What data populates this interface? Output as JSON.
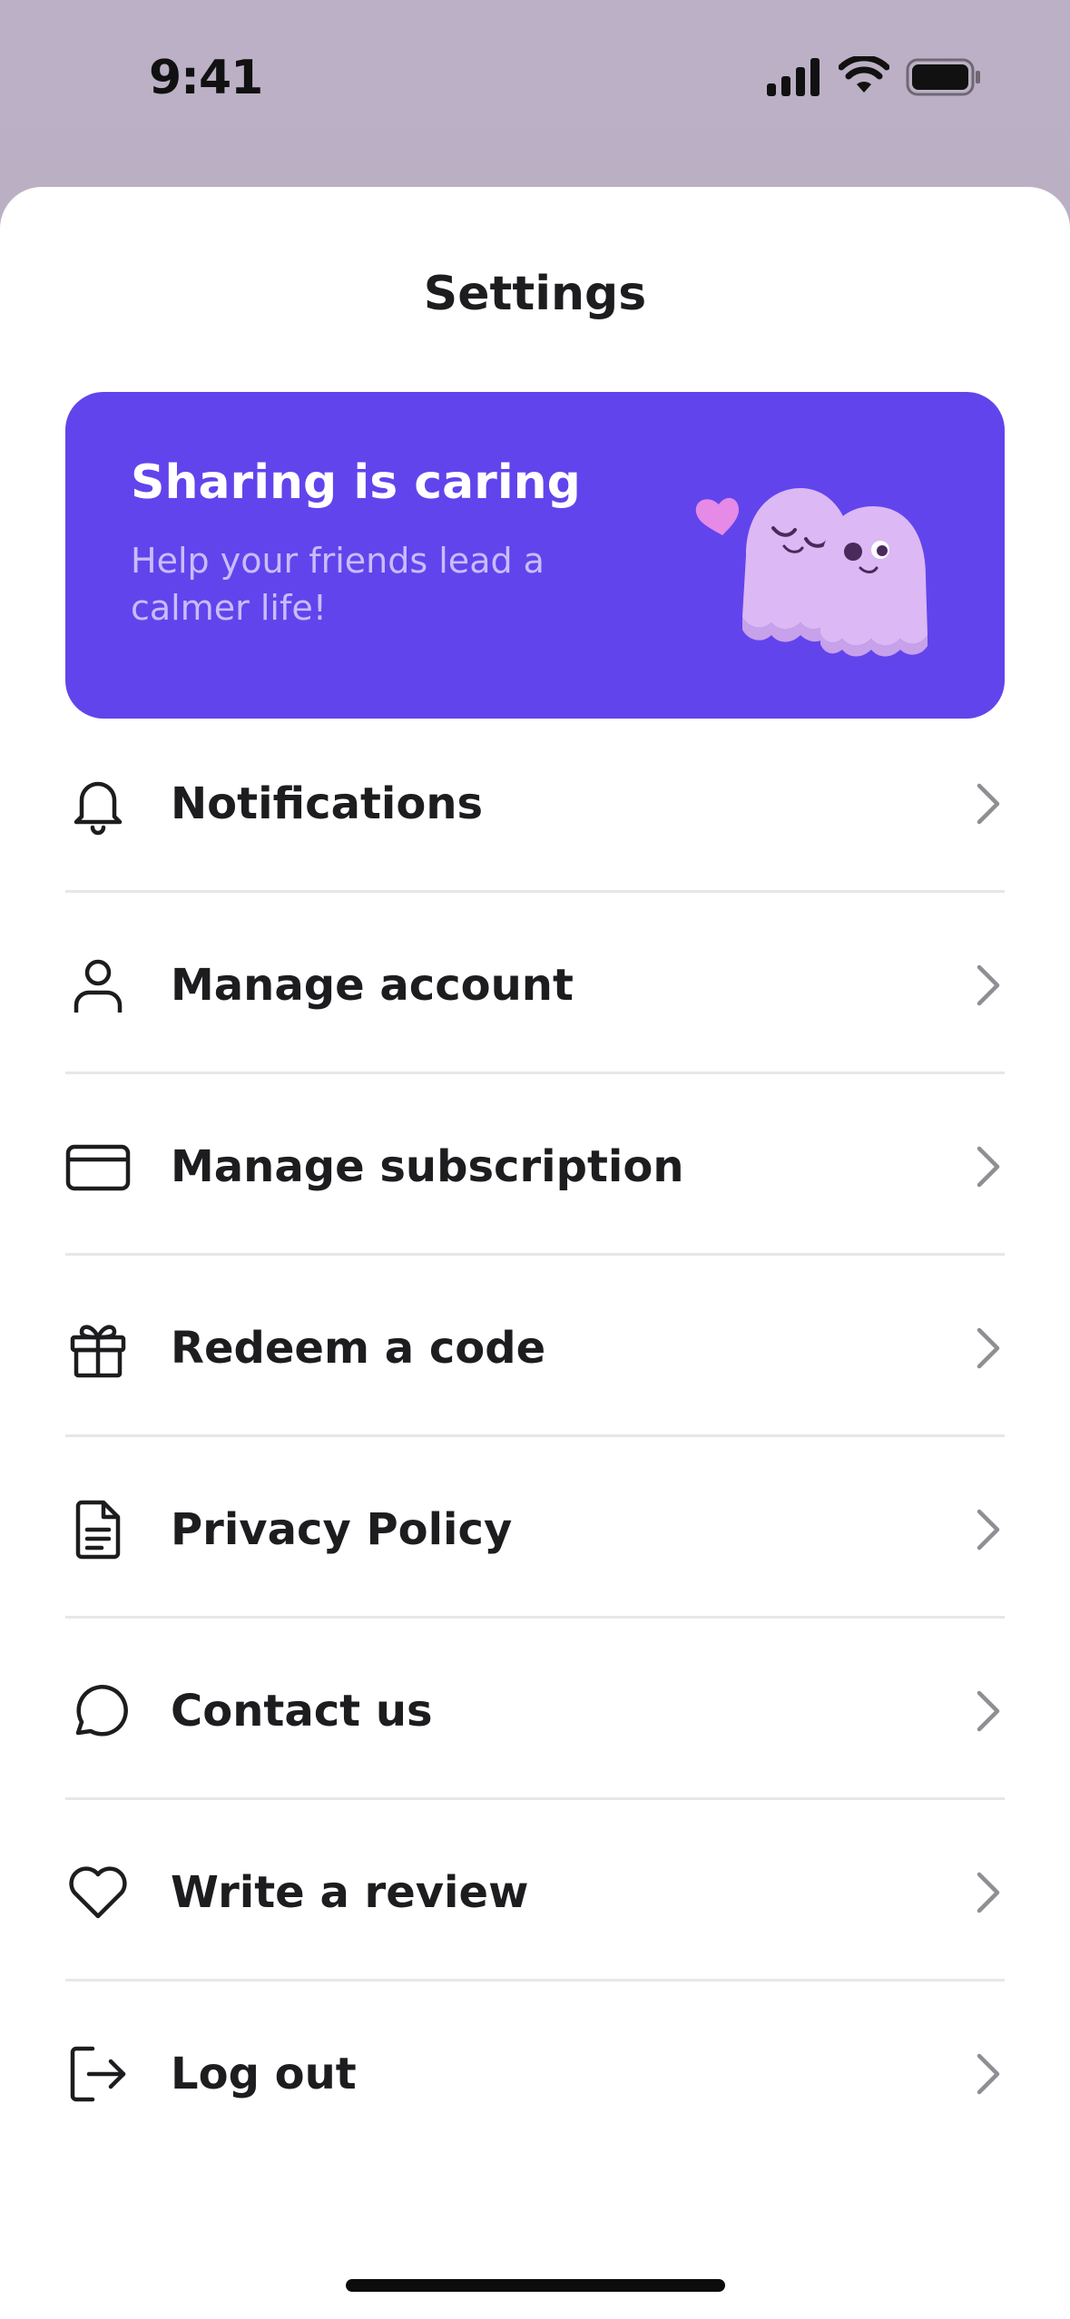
{
  "status_bar": {
    "time": "9:41"
  },
  "sheet": {
    "title": "Settings"
  },
  "promo": {
    "title": "Sharing is caring",
    "subtitle": "Help your friends lead a calmer life!"
  },
  "menu": {
    "items": [
      {
        "label": "Notifications",
        "icon": "bell-icon"
      },
      {
        "label": "Manage account",
        "icon": "user-icon"
      },
      {
        "label": "Manage subscription",
        "icon": "credit-card-icon"
      },
      {
        "label": "Redeem a code",
        "icon": "gift-icon"
      },
      {
        "label": "Privacy Policy",
        "icon": "document-icon"
      },
      {
        "label": "Contact us",
        "icon": "chat-bubble-icon"
      },
      {
        "label": "Write a review",
        "icon": "heart-icon"
      },
      {
        "label": "Log out",
        "icon": "logout-icon"
      }
    ]
  },
  "colors": {
    "promo_background": "#6244ec",
    "promo_subtitle": "#c9bcff",
    "ghost": "#dcb8f4",
    "heart_accent": "#e58ae6",
    "divider": "#e7e7e9",
    "chevron": "#8e8e93"
  }
}
